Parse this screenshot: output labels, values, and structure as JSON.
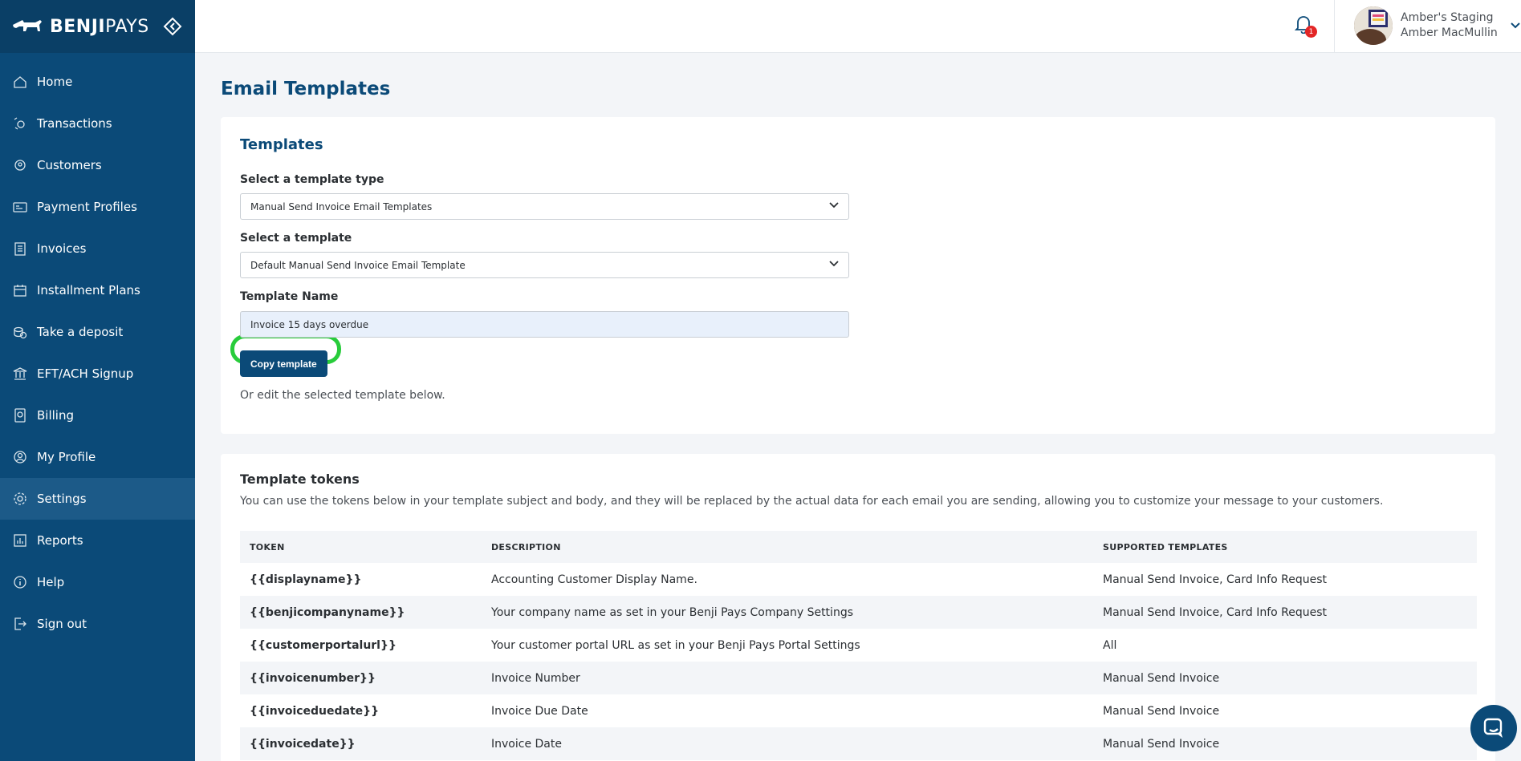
{
  "brand": {
    "name_bold": "BENJI",
    "name_light": "PAYS"
  },
  "sidebar": {
    "items": [
      {
        "label": "Home",
        "icon": "home-icon"
      },
      {
        "label": "Transactions",
        "icon": "transactions-icon"
      },
      {
        "label": "Customers",
        "icon": "customers-icon"
      },
      {
        "label": "Payment Profiles",
        "icon": "payment-profiles-icon"
      },
      {
        "label": "Invoices",
        "icon": "invoices-icon"
      },
      {
        "label": "Installment Plans",
        "icon": "calendar-icon"
      },
      {
        "label": "Take a deposit",
        "icon": "deposit-icon"
      },
      {
        "label": "EFT/ACH Signup",
        "icon": "bank-icon"
      },
      {
        "label": "Billing",
        "icon": "billing-icon"
      },
      {
        "label": "My Profile",
        "icon": "profile-icon"
      },
      {
        "label": "Settings",
        "icon": "gear-icon",
        "active": true
      },
      {
        "label": "Reports",
        "icon": "reports-icon"
      },
      {
        "label": "Help",
        "icon": "help-icon"
      },
      {
        "label": "Sign out",
        "icon": "sign-out-icon"
      }
    ]
  },
  "header": {
    "notifications_count": "1",
    "company": "Amber's Staging",
    "user_name": "Amber MacMullin"
  },
  "page": {
    "title": "Email Templates"
  },
  "templates_card": {
    "title": "Templates",
    "type_label": "Select a template type",
    "type_value": "Manual Send Invoice Email Templates",
    "template_label": "Select a template",
    "template_value": "Default Manual Send Invoice Email Template",
    "name_label": "Template Name",
    "name_value": "Invoice 15 days overdue",
    "copy_button": "Copy template",
    "helper": "Or edit the selected template below."
  },
  "tokens_card": {
    "title": "Template tokens",
    "description": "You can use the tokens below in your template subject and body, and they will be replaced by the actual data for each email you are sending, allowing you to customize your message to your customers.",
    "columns": [
      "TOKEN",
      "DESCRIPTION",
      "SUPPORTED TEMPLATES"
    ],
    "rows": [
      {
        "token": "{{displayname}}",
        "description": "Accounting Customer Display Name.",
        "supported": "Manual Send Invoice, Card Info Request"
      },
      {
        "token": "{{benjicompanyname}}",
        "description": "Your company name as set in your Benji Pays Company Settings",
        "supported": "Manual Send Invoice, Card Info Request"
      },
      {
        "token": "{{customerportalurl}}",
        "description": "Your customer portal URL as set in your Benji Pays Portal Settings",
        "supported": "All"
      },
      {
        "token": "{{invoicenumber}}",
        "description": "Invoice Number",
        "supported": "Manual Send Invoice"
      },
      {
        "token": "{{invoiceduedate}}",
        "description": "Invoice Due Date",
        "supported": "Manual Send Invoice"
      },
      {
        "token": "{{invoicedate}}",
        "description": "Invoice Date",
        "supported": "Manual Send Invoice"
      }
    ]
  },
  "colors": {
    "sidebar": "#0b4a78",
    "accent": "#0b4a78",
    "highlight": "#28cc3b",
    "badge": "#e32626"
  }
}
